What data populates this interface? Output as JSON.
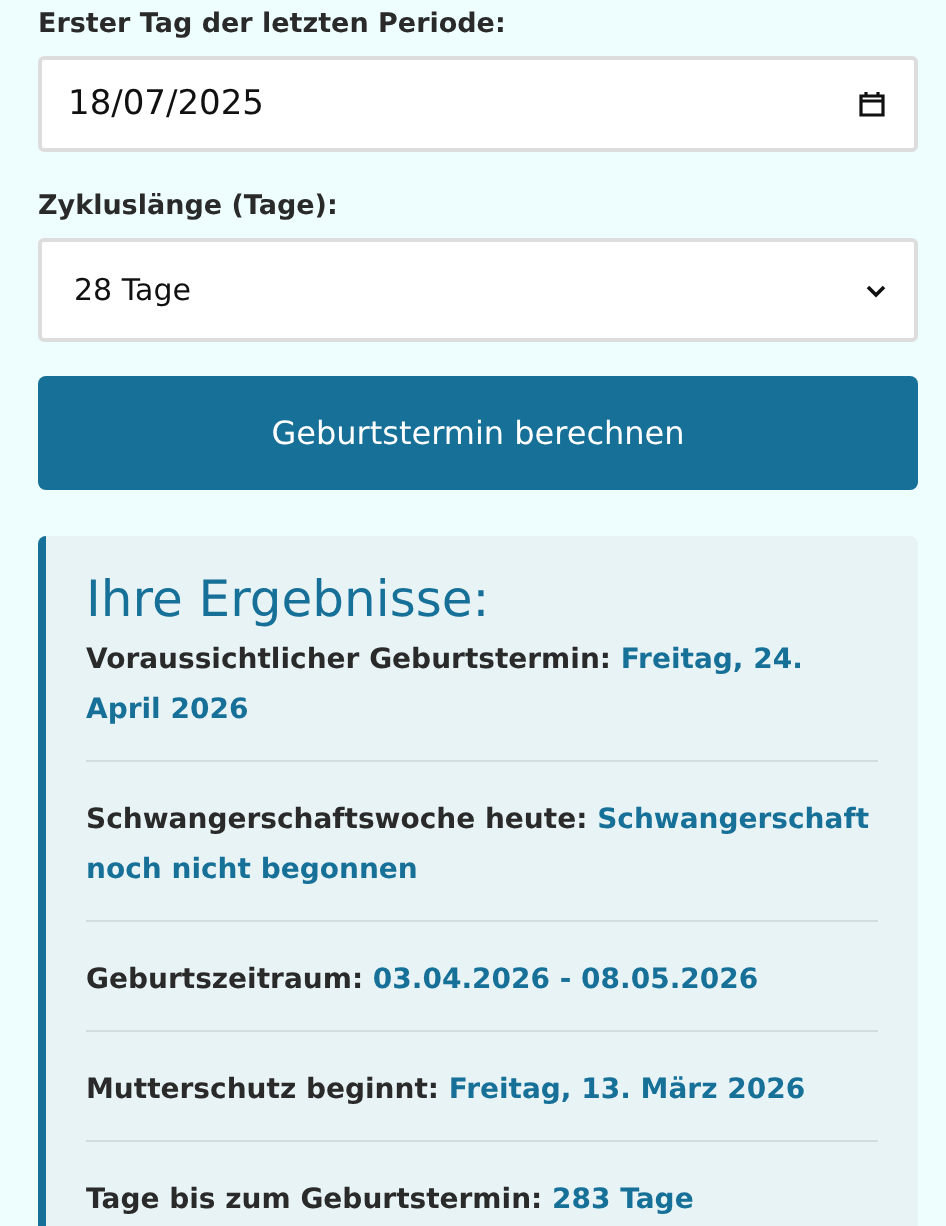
{
  "date_field": {
    "label": "Erster Tag der letzten Periode:",
    "value": "18/07/2025"
  },
  "cycle_field": {
    "label": "Zykluslänge (Tage):",
    "value": "28 Tage"
  },
  "calculate_button": {
    "label": "Geburtstermin berechnen"
  },
  "results": {
    "title": "Ihre Ergebnisse:",
    "rows": [
      {
        "label": "Voraussichtlicher Geburtstermin:",
        "value": "Freitag, 24. April 2026"
      },
      {
        "label": "Schwangerschaftswoche heute:",
        "value": "Schwangerschaft noch nicht begonnen"
      },
      {
        "label": "Geburtszeitraum:",
        "value": "03.04.2026 - 08.05.2026"
      },
      {
        "label": "Mutterschutz beginnt:",
        "value": "Freitag, 13. März 2026"
      },
      {
        "label": "Tage bis zum Geburtstermin:",
        "value": "283 Tage"
      }
    ]
  }
}
